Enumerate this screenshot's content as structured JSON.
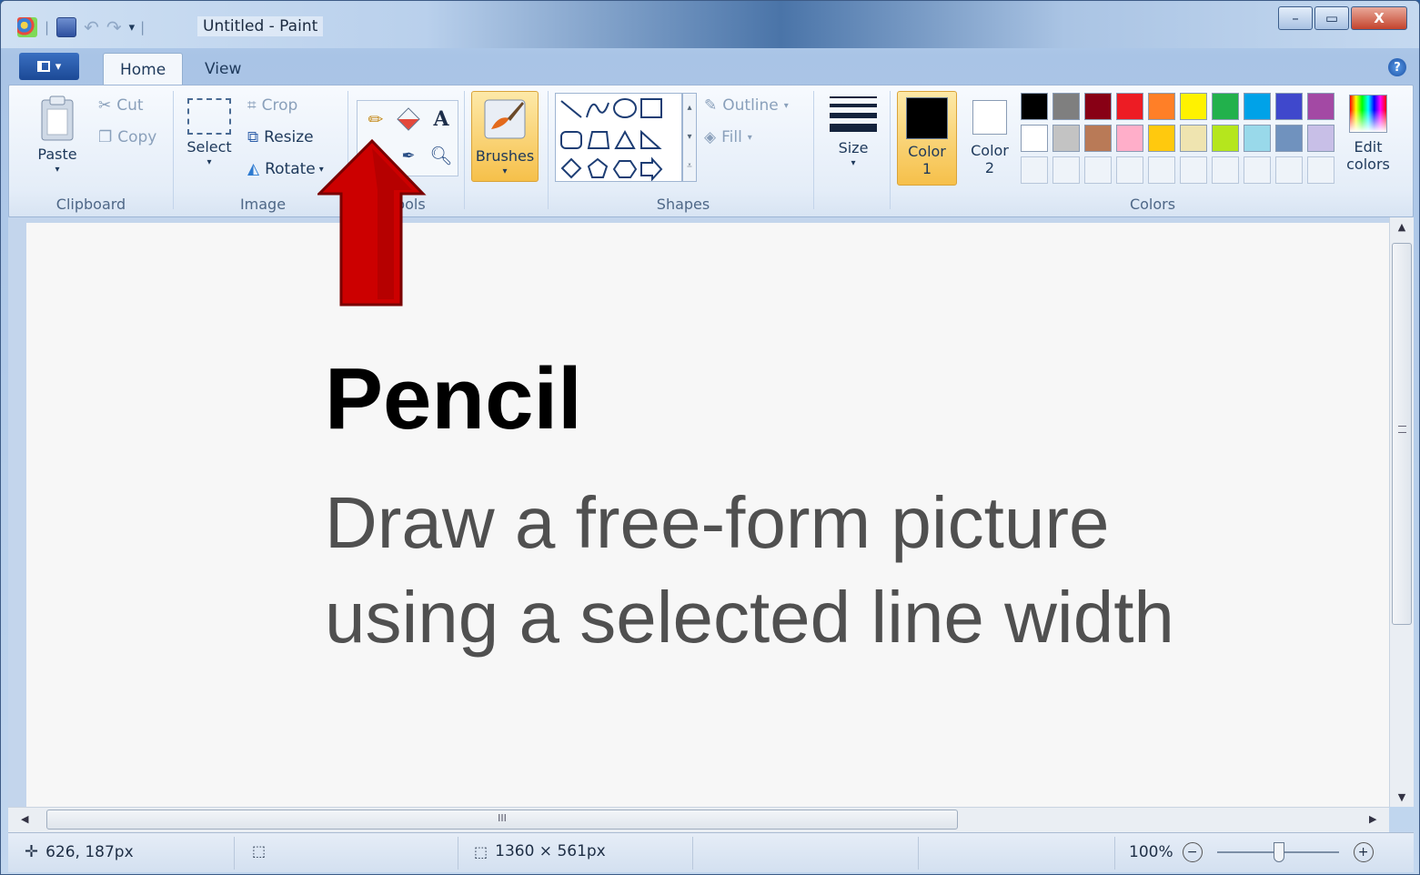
{
  "window": {
    "title": "Untitled - Paint",
    "minimize_glyph": "–",
    "maximize_glyph": "▭",
    "close_glyph": "X"
  },
  "tabs": [
    {
      "label": "Home",
      "active": true
    },
    {
      "label": "View",
      "active": false
    }
  ],
  "help_glyph": "?",
  "ribbon": {
    "clipboard": {
      "label": "Clipboard",
      "paste": "Paste",
      "cut": "Cut",
      "copy": "Copy"
    },
    "image": {
      "label": "Image",
      "select": "Select",
      "crop": "Crop",
      "resize": "Resize",
      "rotate": "Rotate"
    },
    "tools": {
      "label": "Tools"
    },
    "brushes": {
      "label": "Brushes"
    },
    "shapes": {
      "label": "Shapes",
      "outline": "Outline",
      "fill": "Fill"
    },
    "size": {
      "label": "Size"
    },
    "colors": {
      "label": "Colors",
      "color1_line1": "Color",
      "color1_line2": "1",
      "color2_line1": "Color",
      "color2_line2": "2",
      "edit_line1": "Edit",
      "edit_line2": "colors",
      "color1_value": "#000000",
      "color2_value": "#ffffff",
      "palette_row1": [
        "#000000",
        "#7f7f7f",
        "#880015",
        "#ed1c24",
        "#ff7f27",
        "#fff200",
        "#22b14c",
        "#00a2e8",
        "#3f48cc",
        "#a349a4"
      ],
      "palette_row2": [
        "#ffffff",
        "#c3c3c3",
        "#b97a57",
        "#ffaec9",
        "#ffc90e",
        "#efe4b0",
        "#b5e61d",
        "#99d9ea",
        "#7092be",
        "#c8bfe7"
      ]
    }
  },
  "callout": {
    "title": "Pencil",
    "description_line1": "Draw a free-form picture",
    "description_line2": "using a selected line width",
    "arrow_color": "#cc0000"
  },
  "scrollbar": {
    "grip": "III"
  },
  "statusbar": {
    "cursor_position": "626, 187px",
    "canvas_size": "1360 × 561px",
    "zoom": "100%"
  }
}
